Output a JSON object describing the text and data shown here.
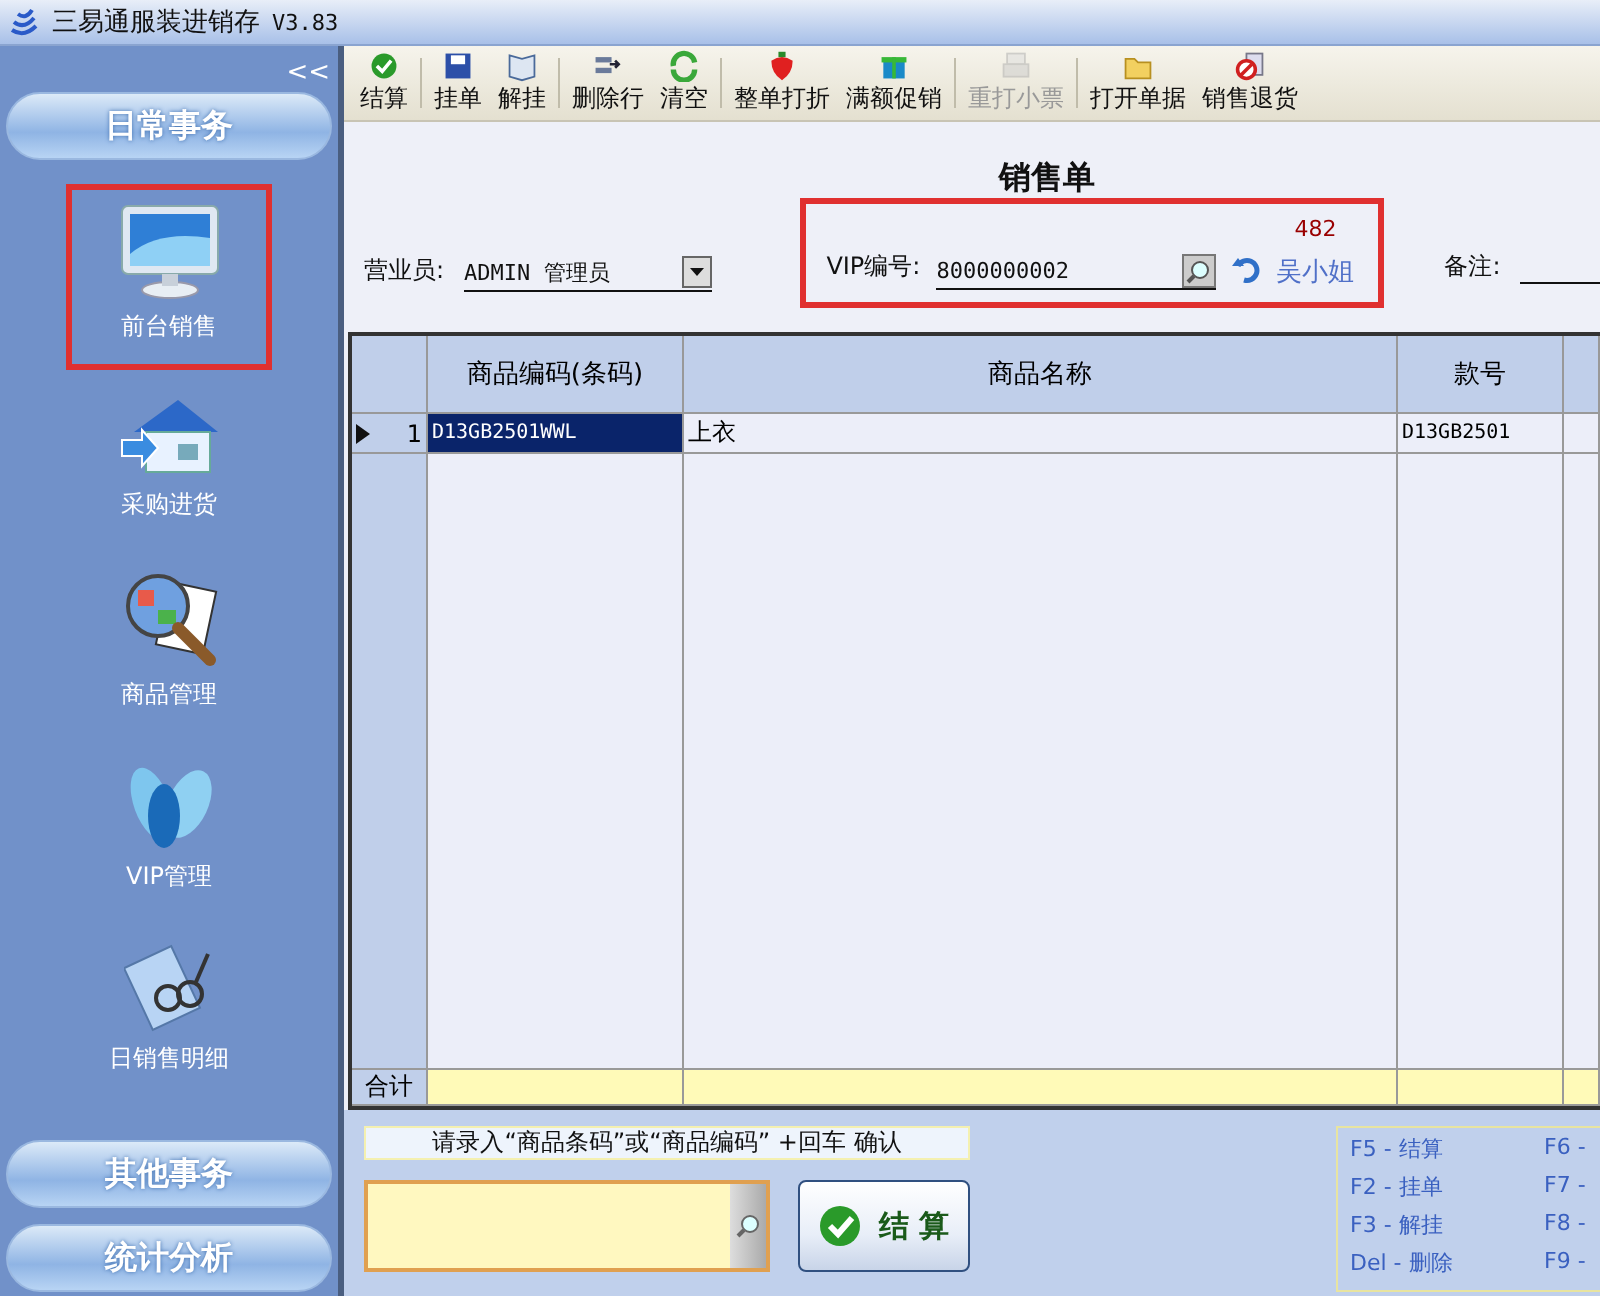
{
  "window": {
    "title": "三易通服装进销存",
    "version": "V3.83"
  },
  "sidebar": {
    "collapse_glyph": "<<",
    "header": "日常事务",
    "items": [
      {
        "label": "前台销售",
        "kind": "monitor",
        "highlighted": true
      },
      {
        "label": "采购进货",
        "kind": "house",
        "highlighted": false
      },
      {
        "label": "商品管理",
        "kind": "magnifier",
        "highlighted": false
      },
      {
        "label": "VIP管理",
        "kind": "petals",
        "highlighted": false
      },
      {
        "label": "日销售明细",
        "kind": "notebook",
        "highlighted": false
      }
    ],
    "footer_sections": [
      "其他事务",
      "统计分析"
    ]
  },
  "toolbar": [
    {
      "label": "结算",
      "kind": "check",
      "disabled": false,
      "separator_after": true
    },
    {
      "label": "挂单",
      "kind": "disk",
      "disabled": false,
      "separator_after": false
    },
    {
      "label": "解挂",
      "kind": "book",
      "disabled": false,
      "separator_after": true
    },
    {
      "label": "删除行",
      "kind": "arrow",
      "disabled": false,
      "separator_after": false
    },
    {
      "label": "清空",
      "kind": "refresh",
      "disabled": false,
      "separator_after": true
    },
    {
      "label": "整单打折",
      "kind": "strawberry",
      "disabled": false,
      "separator_after": false
    },
    {
      "label": "满额促销",
      "kind": "gift",
      "disabled": false,
      "separator_after": true
    },
    {
      "label": "重打小票",
      "kind": "printer",
      "disabled": true,
      "separator_after": true
    },
    {
      "label": "打开单据",
      "kind": "folder",
      "disabled": false,
      "separator_after": false
    },
    {
      "label": "销售退货",
      "kind": "nosign",
      "disabled": false,
      "separator_after": false
    }
  ],
  "form": {
    "title": "销售单",
    "salesperson_label": "营业员:",
    "salesperson": "ADMIN 管理员",
    "vip_label": "VIP编号:",
    "vip_number": "8000000002",
    "vip_points": "482",
    "vip_name": "吴小姐",
    "vip_highlighted": true,
    "remarks_label": "备注:"
  },
  "table": {
    "columns": [
      "商品编码(条码)",
      "商品名称",
      "款号"
    ],
    "rows": [
      {
        "index": "1",
        "selected": true,
        "cells": [
          "D13GB2501WWL",
          "上衣",
          "D13GB2501"
        ]
      }
    ],
    "summary_label": "合计"
  },
  "entry": {
    "hint": "请录入“商品条码”或“商品编码” +回车 确认",
    "settle_button": "结 算"
  },
  "shortcuts": [
    [
      "F5 - 结算",
      "F2 - 挂单",
      "F3 - 解挂",
      "Del - 删除"
    ],
    [
      "F6 -",
      "F7 -",
      "F8 -",
      "F9 -"
    ]
  ]
}
